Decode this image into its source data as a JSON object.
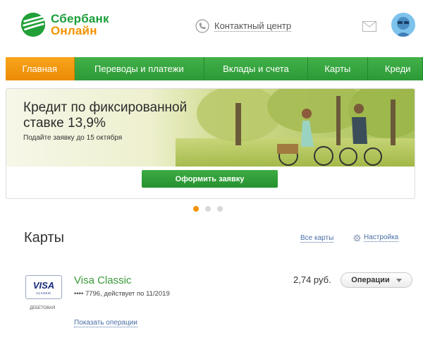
{
  "header": {
    "logo_line1": "Сбербанк",
    "logo_line2": "Онлайн",
    "contact_label": "Контактный центр"
  },
  "nav": {
    "items": [
      {
        "label": "Главная",
        "active": true
      },
      {
        "label": "Переводы и платежи",
        "active": false
      },
      {
        "label": "Вклады и счета",
        "active": false
      },
      {
        "label": "Карты",
        "active": false
      },
      {
        "label": "Креди",
        "active": false
      }
    ]
  },
  "banner": {
    "title_line1": "Кредит по фиксированной",
    "title_line2": "ставке 13,9%",
    "subtitle": "Подайте заявку до 15 октября",
    "button_label": "Оформить заявку",
    "slides_total": 3,
    "active_slide": 1
  },
  "cards_section": {
    "title": "Карты",
    "all_cards_label": "Все карты",
    "settings_label": "Настройка",
    "card": {
      "brand": "VISA",
      "brand_sub": "CLASSIC",
      "type": "ДЕБЕТОВАЯ",
      "name": "Visa Classic",
      "info": "•••• 7796, действует по 11/2019",
      "balance": "2,74 руб.",
      "operations_label": "Операции",
      "show_operations_label": "Показать операции"
    }
  },
  "colors": {
    "brand_green": "#1a9f3a",
    "brand_orange": "#f39200",
    "link_blue": "#4a6fa5"
  }
}
